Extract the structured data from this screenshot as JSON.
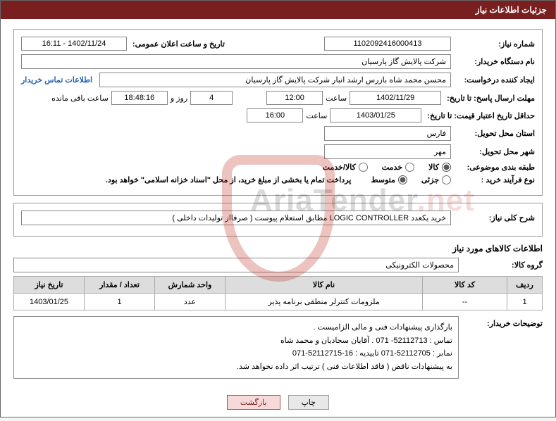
{
  "header": {
    "title": "جزئیات اطلاعات نیاز"
  },
  "fields": {
    "need_no_label": "شماره نیاز:",
    "need_no": "1102092416000413",
    "announce_label": "تاریخ و ساعت اعلان عمومی:",
    "announce_val": "1402/11/24 - 16:11",
    "buyer_org_label": "نام دستگاه خریدار:",
    "buyer_org": "شرکت پالایش گاز پارسیان",
    "requester_label": "ایجاد کننده درخواست:",
    "requester": "محسن محمد شاه بازرس ارشد انبار شرکت پالایش گاز پارسیان",
    "contact_link": "اطلاعات تماس خریدار",
    "reply_deadline_label": "مهلت ارسال پاسخ: تا تاریخ:",
    "reply_date": "1402/11/29",
    "hour_label": "ساعت",
    "reply_time": "12:00",
    "days_remaining": "4",
    "days_word": "روز و",
    "time_remaining": "18:48:16",
    "remaining_word": "ساعت باقی مانده",
    "price_valid_label": "حداقل تاریخ اعتبار قیمت: تا تاریخ:",
    "price_date": "1403/01/25",
    "price_time": "16:00",
    "province_label": "استان محل تحویل:",
    "province": "فارس",
    "city_label": "شهر محل تحویل:",
    "city": "مهر",
    "category_label": "طبقه بندی موضوعی:",
    "radio_goods": "کالا",
    "radio_service": "خدمت",
    "radio_goods_service": "کالا/خدمت",
    "purchase_type_label": "نوع فرآیند خرید :",
    "radio_partial": "جزئی",
    "radio_medium": "متوسط",
    "treasury_note": "پرداخت تمام یا بخشی از مبلغ خرید، از محل \"اسناد خزانه اسلامی\" خواهد بود.",
    "overall_label": "شرح کلی نیاز:",
    "overall_desc": "خرید یکعدد LOGIC CONTROLLER مطابق استعلام پیوست ( صرفااز تولیدات داخلی )",
    "items_section_title": "اطلاعات کالاهای مورد نیاز",
    "group_label": "گروه کالا:",
    "group_val": "محصولات الکترونیکی",
    "buyer_notes_label": "توضیحات خریدار:",
    "buyer_notes": [
      "بارگذاری پیشنهادات فنی و مالی الزامیست .",
      "تماس : 52112713- 071 . آقایان سجادیان و محمد شاه",
      "نمابر : 52112705-071 تاییدیه : 16-52112715-071",
      "به پیشنهادات ناقص ( فاقد اطلاعات فنی ) ترتیب اثر داده نخواهد شد."
    ]
  },
  "table": {
    "headers": {
      "row": "ردیف",
      "code": "کد کالا",
      "name": "نام کالا",
      "unit": "واحد شمارش",
      "qty": "تعداد / مقدار",
      "need_date": "تاریخ نیاز"
    },
    "rows": [
      {
        "row": "1",
        "code": "--",
        "name": "ملزومات کنترلر منطقی برنامه پذیر",
        "unit": "عدد",
        "qty": "1",
        "need_date": "1403/01/25"
      }
    ]
  },
  "buttons": {
    "print": "چاپ",
    "back": "بازگشت"
  },
  "watermark": {
    "text1": "AriaTender",
    "text2": ".net"
  }
}
